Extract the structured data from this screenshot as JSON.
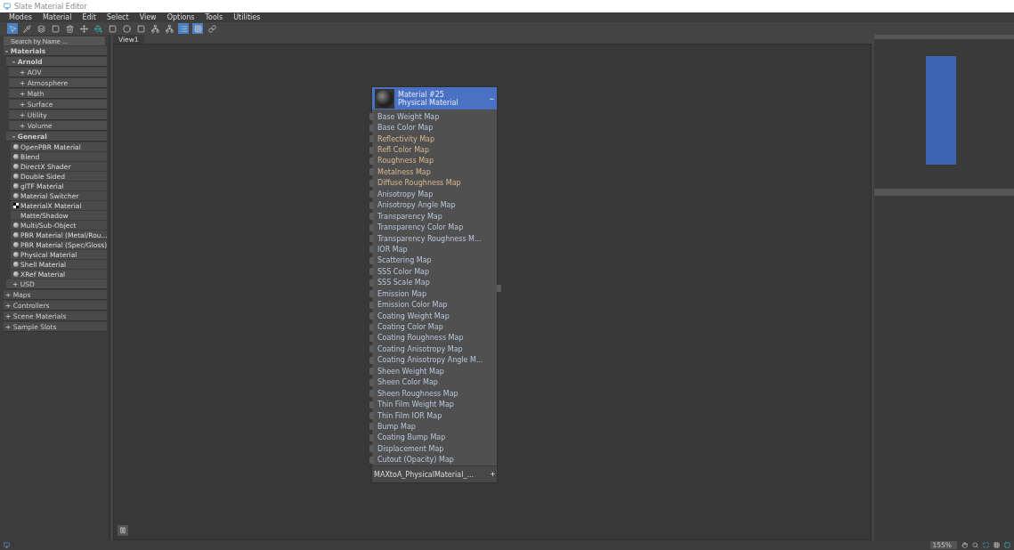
{
  "window": {
    "title": "Slate Material Editor"
  },
  "menu": [
    "Modes",
    "Material",
    "Edit",
    "Select",
    "View",
    "Options",
    "Tools",
    "Utilities"
  ],
  "toolbar": [
    {
      "kind": "pointer",
      "selected": true
    },
    {
      "kind": "picker",
      "selected": false
    },
    {
      "kind": "assign",
      "selected": false
    },
    {
      "kind": "reset",
      "selected": false
    },
    {
      "kind": "delete",
      "selected": false
    },
    {
      "kind": "move",
      "selected": false
    },
    {
      "kind": "bucket",
      "selected": false
    },
    {
      "kind": "background",
      "selected": false
    },
    {
      "kind": "map",
      "selected": false
    },
    {
      "kind": "zero",
      "selected": false
    },
    {
      "kind": "layout",
      "selected": false
    },
    {
      "kind": "children",
      "selected": false
    },
    {
      "kind": "list",
      "selected": true
    },
    {
      "kind": "grid",
      "selected": true
    },
    {
      "kind": "link",
      "selected": false
    }
  ],
  "browser": {
    "search_placeholder": "Search by Name ...",
    "groups": [
      {
        "label": "- Materials",
        "expanded": true,
        "children": [
          {
            "label": "- Arnold",
            "expanded": true,
            "children": [
              {
                "label": "+ AOV",
                "expanded": false
              },
              {
                "label": "+ Atmosphere",
                "expanded": false
              },
              {
                "label": "+ Math",
                "expanded": false
              },
              {
                "label": "+ Surface",
                "expanded": false
              },
              {
                "label": "+ Utility",
                "expanded": false
              },
              {
                "label": "+ Volume",
                "expanded": false
              }
            ]
          },
          {
            "label": "- General",
            "expanded": true,
            "items": [
              {
                "label": "OpenPBR Material",
                "kind": "sphere"
              },
              {
                "label": "Blend",
                "kind": "sphere"
              },
              {
                "label": "DirectX Shader",
                "kind": "sphere"
              },
              {
                "label": "Double Sided",
                "kind": "sphere"
              },
              {
                "label": "glTF Material",
                "kind": "sphere"
              },
              {
                "label": "Material Switcher",
                "kind": "sphere"
              },
              {
                "label": "MaterialX Material",
                "kind": "checker"
              },
              {
                "label": "Matte/Shadow",
                "kind": "none"
              },
              {
                "label": "Multi/Sub-Object",
                "kind": "sphere"
              },
              {
                "label": "PBR Material (Metal/Rou...",
                "kind": "sphere"
              },
              {
                "label": "PBR Material (Spec/Gloss)",
                "kind": "sphere"
              },
              {
                "label": "Physical Material",
                "kind": "sphere"
              },
              {
                "label": "Shell Material",
                "kind": "sphere"
              },
              {
                "label": "XRef Material",
                "kind": "sphere"
              }
            ]
          },
          {
            "label": "+ USD",
            "expanded": false
          }
        ]
      },
      {
        "label": "+ Maps",
        "expanded": false
      },
      {
        "label": "+ Controllers",
        "expanded": false
      },
      {
        "label": "+ Scene Materials",
        "expanded": false
      },
      {
        "label": "+ Sample Slots",
        "expanded": false
      }
    ]
  },
  "view_tab": {
    "label": "View1",
    "selected": true
  },
  "node": {
    "title": "Material #25",
    "subtitle": "Physical Material",
    "collapse": "−",
    "footer": "MAXtoA_PhysicalMaterial_...",
    "add": "+",
    "ports": [
      "Base Weight Map",
      "Base Color Map",
      "Reflectivity Map",
      "Refl Color Map",
      "Roughness Map",
      "Metalness Map",
      "Diffuse Roughness Map",
      "Anisotropy Map",
      "Anisotropy Angle Map",
      "Transparency Map",
      "Transparency Color Map",
      "Transparency Roughness M...",
      "IOR Map",
      "Scattering Map",
      "SSS Color Map",
      "SSS Scale Map",
      "Emission Map",
      "Emission Color Map",
      "Coating Weight Map",
      "Coating Color Map",
      "Coating Roughness Map",
      "Coating Anisotropy Map",
      "Coating Anisotropy Angle M...",
      "Sheen Weight Map",
      "Sheen Color Map",
      "Sheen Roughness Map",
      "Thin Film Weight Map",
      "Thin Film IOR Map",
      "Bump Map",
      "Coating Bump Map",
      "Displacement Map",
      "Cutout (Opacity) Map"
    ]
  },
  "status_bar": {
    "zoom": "155%"
  }
}
